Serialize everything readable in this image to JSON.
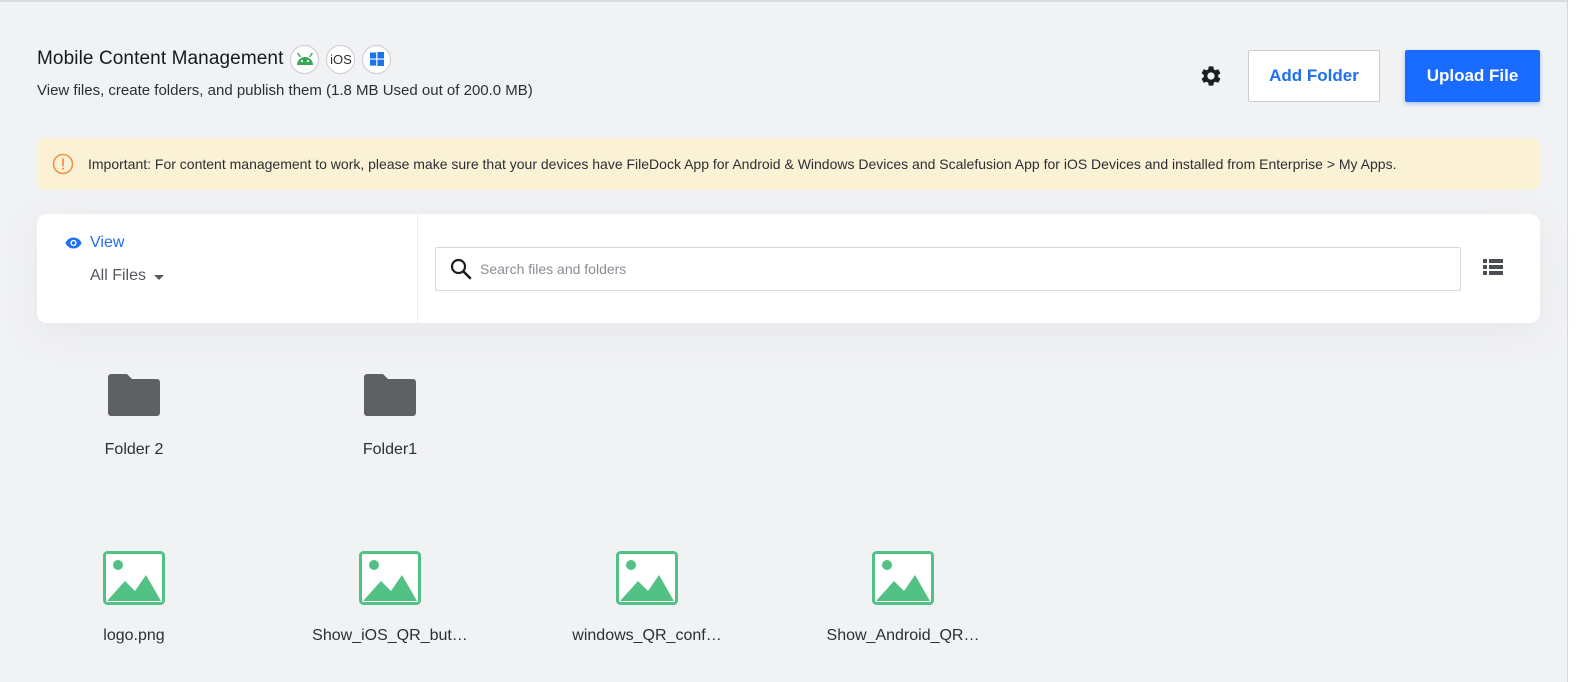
{
  "header": {
    "title": "Mobile Content Management",
    "platforms": [
      "android-icon",
      "ios",
      "windows-icon"
    ],
    "ios_label": "iOS",
    "subtitle": "View files, create folders, and publish them (1.8 MB Used out of 200.0 MB)"
  },
  "actions": {
    "settings_icon": "gear-icon",
    "add_folder_label": "Add Folder",
    "upload_file_label": "Upload File"
  },
  "notice": {
    "icon": "info-circle-icon",
    "text": "Important: For content management to work, please make sure that your devices have FileDock App for Android & Windows Devices and Scalefusion App for iOS Devices and installed from Enterprise > My Apps."
  },
  "filter": {
    "view_label": "View",
    "view_icon": "eye-icon",
    "selected_view": "All Files",
    "search_placeholder": "Search files and folders",
    "list_view_icon": "list-view-icon"
  },
  "folders": [
    {
      "name": "Folder 2",
      "icon": "folder-icon"
    },
    {
      "name": "Folder1",
      "icon": "folder-icon"
    }
  ],
  "files": [
    {
      "name": "logo.png",
      "icon": "image-file-icon"
    },
    {
      "name": "Show_iOS_QR_but…",
      "icon": "image-file-icon"
    },
    {
      "name": "windows_QR_conf…",
      "icon": "image-file-icon"
    },
    {
      "name": "Show_Android_QR…",
      "icon": "image-file-icon"
    }
  ],
  "colors": {
    "accent": "#1a6bff",
    "android_green": "#3aa85a",
    "windows_blue": "#1a73e8",
    "notice_bg": "#fbf2d6",
    "notice_icon": "#f0924a",
    "folder_gray": "#5f6062",
    "image_green": "#52c184"
  }
}
